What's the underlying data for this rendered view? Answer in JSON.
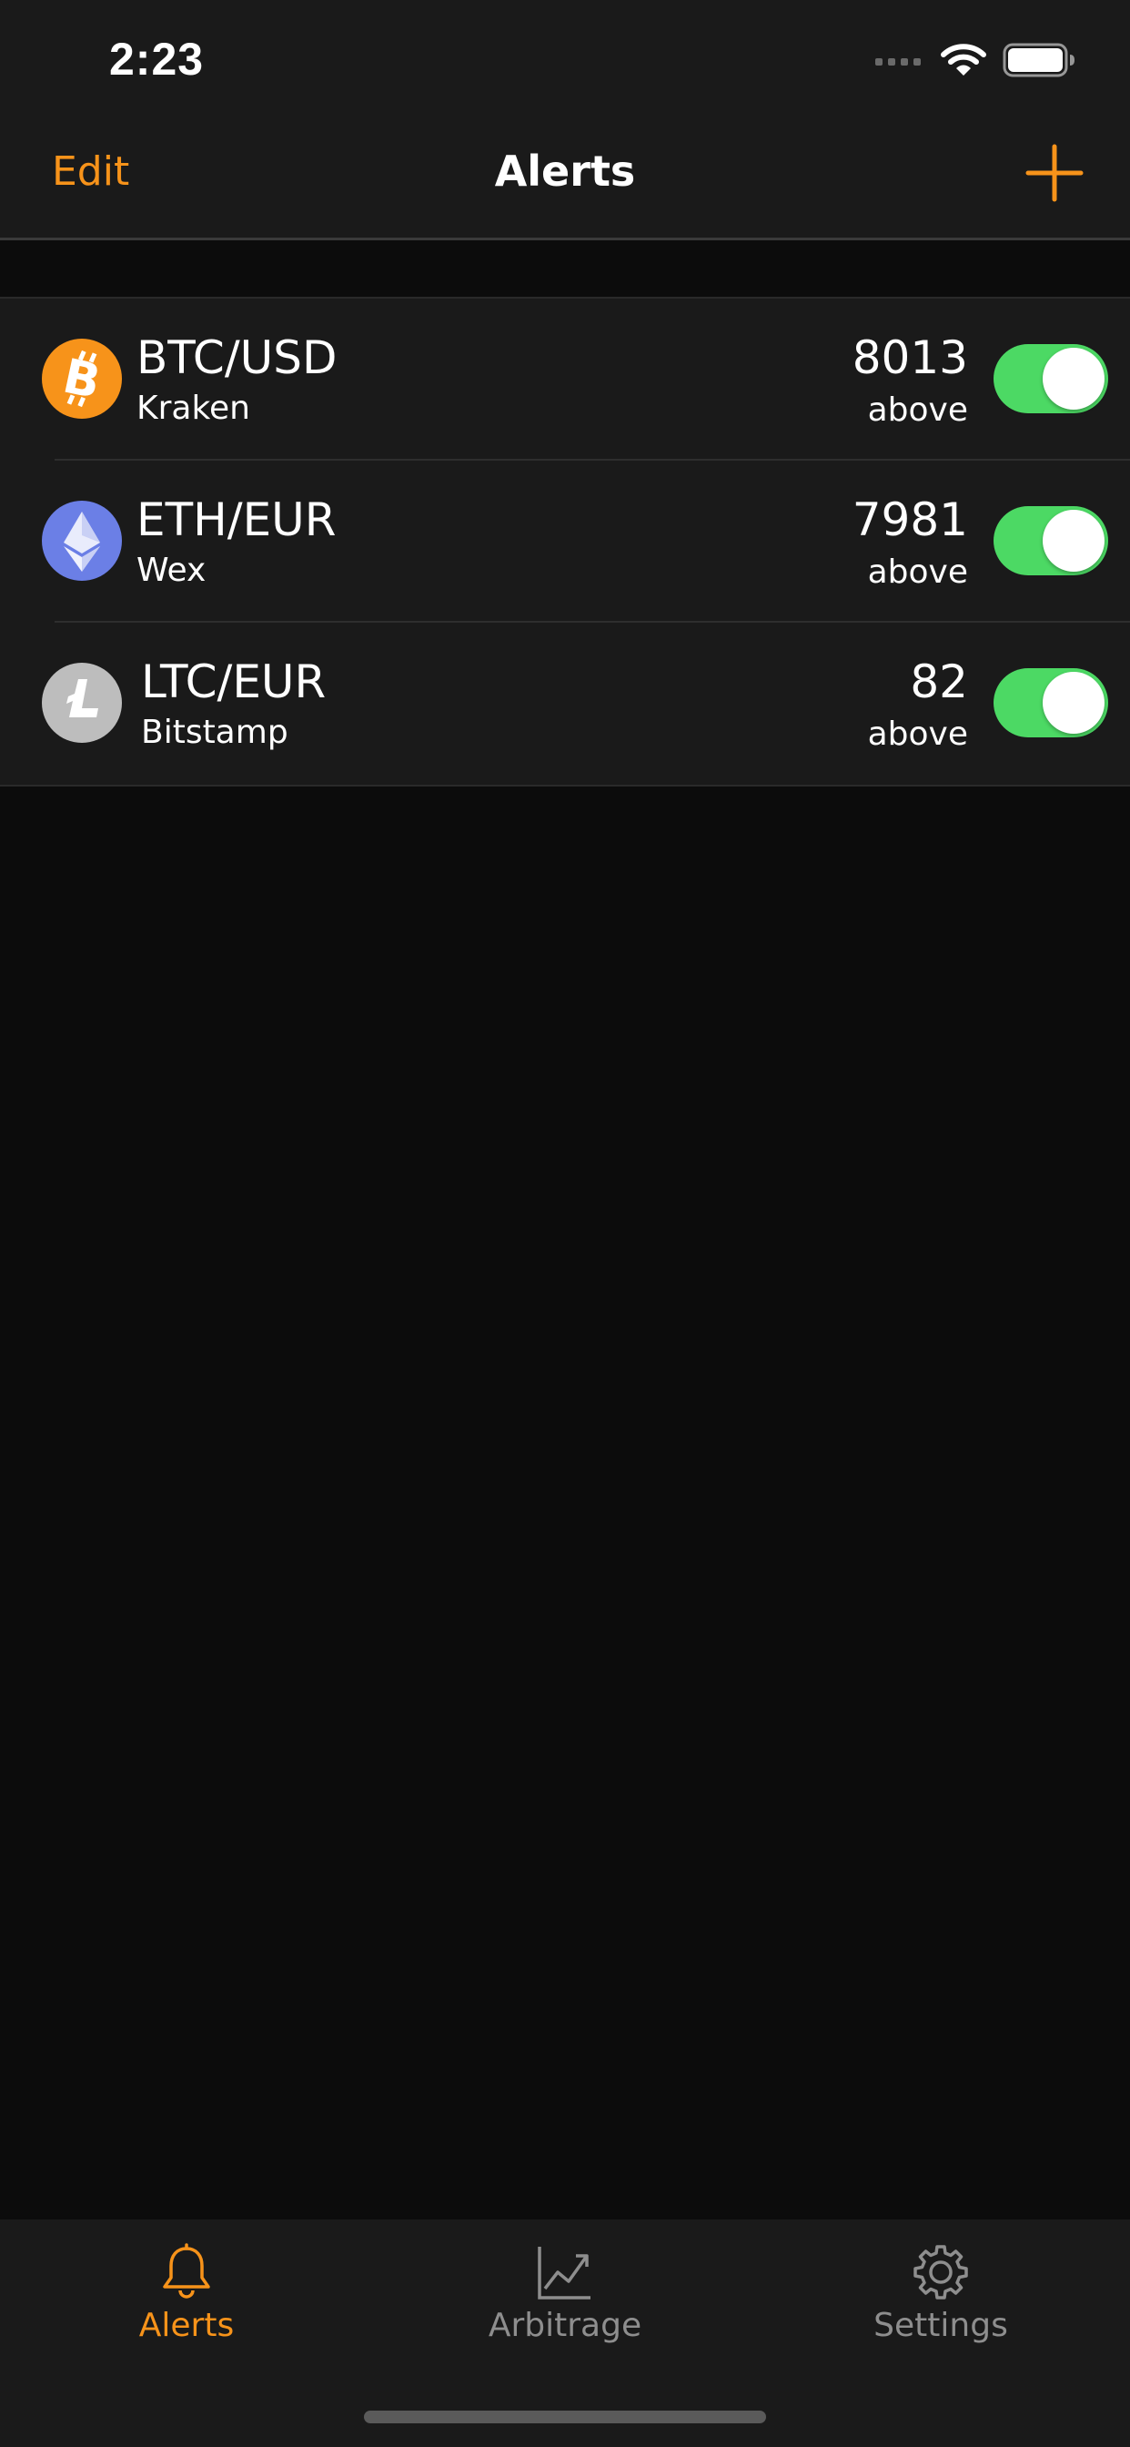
{
  "status_bar": {
    "time": "2:23",
    "icons": [
      "signal-icon",
      "wifi-icon",
      "battery-icon"
    ]
  },
  "nav": {
    "edit_label": "Edit",
    "title": "Alerts",
    "add_icon": "plus-icon"
  },
  "alerts": [
    {
      "pair": "BTC/USD",
      "exchange": "Kraken",
      "price": "8013",
      "direction": "above",
      "enabled": true,
      "icon": "bitcoin-icon"
    },
    {
      "pair": "ETH/EUR",
      "exchange": "Wex",
      "price": "7981",
      "direction": "above",
      "enabled": true,
      "icon": "ethereum-icon"
    },
    {
      "pair": "LTC/EUR",
      "exchange": "Bitstamp",
      "price": "82",
      "direction": "above",
      "enabled": true,
      "icon": "litecoin-icon"
    }
  ],
  "tabs": [
    {
      "label": "Alerts",
      "icon": "bell-icon",
      "active": true
    },
    {
      "label": "Arbitrage",
      "icon": "chart-icon",
      "active": false
    },
    {
      "label": "Settings",
      "icon": "gear-icon",
      "active": false
    }
  ],
  "colors": {
    "accent": "#f7931a",
    "toggle_on": "#4cd964",
    "background": "#0c0c0c",
    "surface": "#1a1a1a",
    "tab_inactive": "#8e8e8e"
  }
}
